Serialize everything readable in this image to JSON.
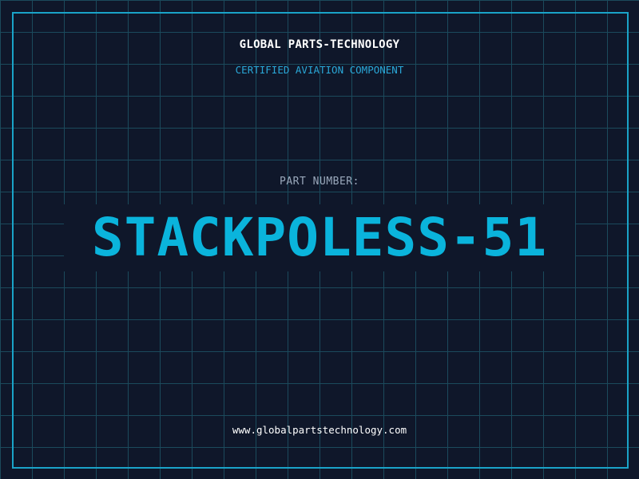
{
  "header": {
    "company": "GLOBAL PARTS-TECHNOLOGY",
    "subtitle": "CERTIFIED AVIATION COMPONENT"
  },
  "part": {
    "label": "PART NUMBER:",
    "number": "STACKPOLESS-51"
  },
  "footer": {
    "url": "www.globalpartstechnology.com"
  },
  "colors": {
    "background": "#0f172a",
    "grid": "#1b4a5c",
    "border": "#1aa3c8",
    "accent": "#0ab4dc",
    "subtitle": "#2aa8d8",
    "label": "#9aa8bb",
    "text": "#ffffff"
  }
}
